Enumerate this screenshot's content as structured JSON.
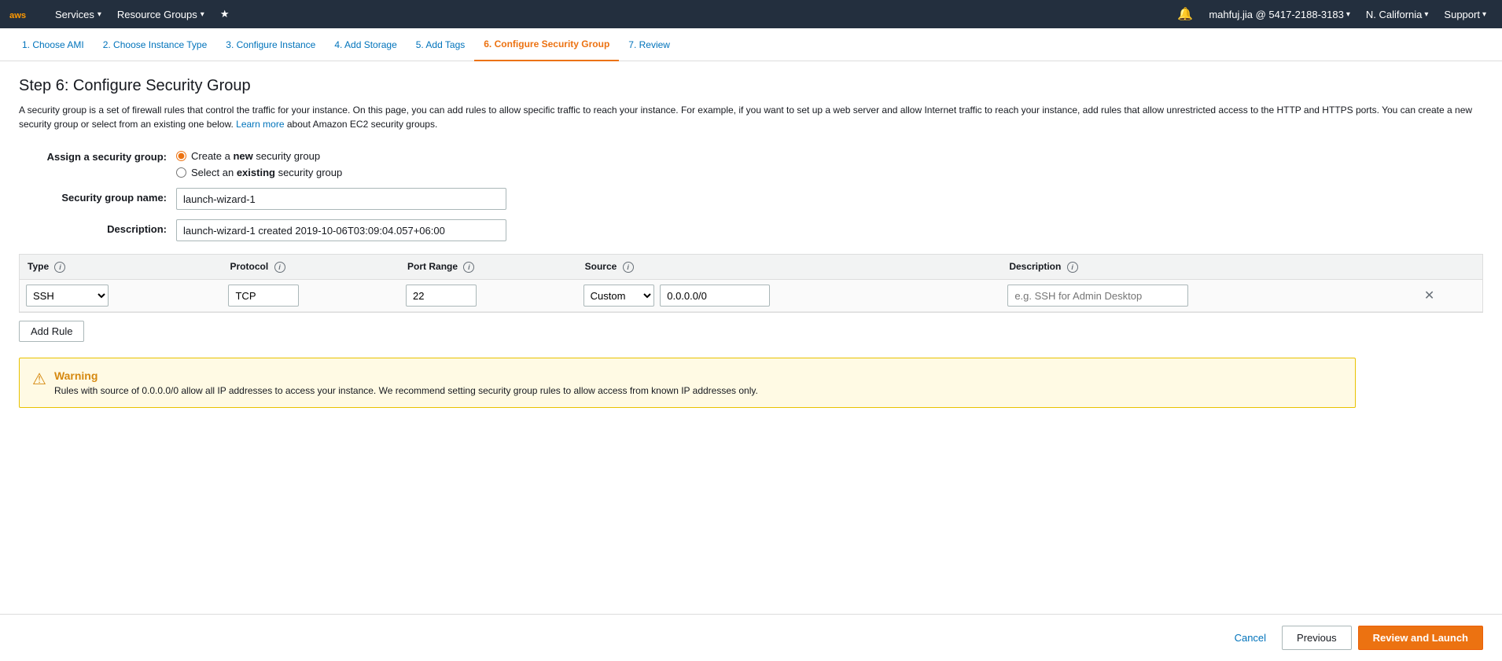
{
  "topnav": {
    "services_label": "Services",
    "resource_groups_label": "Resource Groups",
    "bell_label": "Notifications",
    "user_label": "mahfuj.jia @ 5417-2188-3183",
    "region_label": "N. California",
    "support_label": "Support"
  },
  "wizard_tabs": [
    {
      "id": "tab-ami",
      "label": "1. Choose AMI",
      "active": false
    },
    {
      "id": "tab-instance-type",
      "label": "2. Choose Instance Type",
      "active": false
    },
    {
      "id": "tab-instance",
      "label": "3. Configure Instance",
      "active": false
    },
    {
      "id": "tab-storage",
      "label": "4. Add Storage",
      "active": false
    },
    {
      "id": "tab-tags",
      "label": "5. Add Tags",
      "active": false
    },
    {
      "id": "tab-security",
      "label": "6. Configure Security Group",
      "active": true
    },
    {
      "id": "tab-review",
      "label": "7. Review",
      "active": false
    }
  ],
  "page": {
    "title": "Step 6: Configure Security Group",
    "description_p1": "A security group is a set of firewall rules that control the traffic for your instance. On this page, you can add rules to allow specific traffic to reach your instance. For example, if you want to set up a web server and allow Internet traffic to reach your instance, add rules that allow unrestricted access to the HTTP and HTTPS ports. You can create a new security group or select from an existing one below.",
    "description_link": "Learn more",
    "description_p2": " about Amazon EC2 security groups."
  },
  "form": {
    "assign_label": "Assign a security group:",
    "radio_new_label": "Create a ",
    "radio_new_bold": "new",
    "radio_new_suffix": " security group",
    "radio_existing_label": "Select an ",
    "radio_existing_bold": "existing",
    "radio_existing_suffix": " security group",
    "sg_name_label": "Security group name:",
    "sg_name_value": "launch-wizard-1",
    "sg_name_placeholder": "",
    "description_label": "Description:",
    "description_value": "launch-wizard-1 created 2019-10-06T03:09:04.057+06:00",
    "description_placeholder": ""
  },
  "rules_table": {
    "columns": [
      {
        "id": "type",
        "label": "Type"
      },
      {
        "id": "protocol",
        "label": "Protocol"
      },
      {
        "id": "port_range",
        "label": "Port Range"
      },
      {
        "id": "source",
        "label": "Source"
      },
      {
        "id": "description",
        "label": "Description"
      }
    ],
    "rows": [
      {
        "type": "SSH",
        "protocol": "TCP",
        "port_range": "22",
        "source_select": "Custom",
        "source_value": "0.0.0.0/0",
        "description_placeholder": "e.g. SSH for Admin Desktop"
      }
    ]
  },
  "add_rule_btn": "Add Rule",
  "warning": {
    "title": "Warning",
    "text": "Rules with source of 0.0.0.0/0 allow all IP addresses to access your instance. We recommend setting security group rules to allow access from known IP addresses only."
  },
  "footer": {
    "cancel_label": "Cancel",
    "previous_label": "Previous",
    "review_label": "Review and Launch"
  }
}
